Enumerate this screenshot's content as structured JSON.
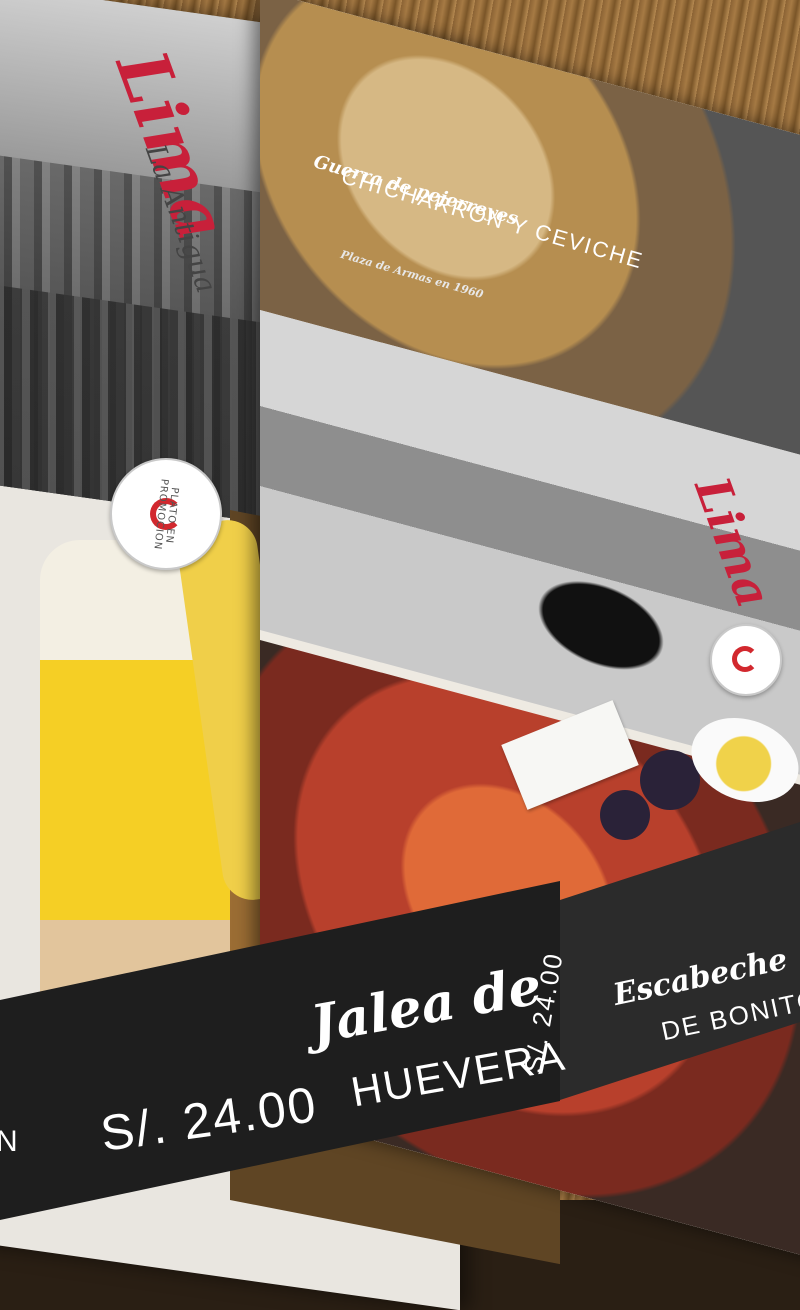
{
  "scene": {
    "description_tags": [
      "restaurant-menu",
      "peruvian-dishes"
    ]
  },
  "menu": {
    "top_right_item": {
      "script_title": "Guerra de pejerreyes",
      "name": "CHICHARRON Y CEVICHE",
      "caption": "Plaza de Armas en 1960"
    },
    "logo": {
      "word": "Lima",
      "sub": "La Antigua"
    },
    "badge_text": "PLATO EN PROMOCION",
    "middle_item": {
      "script": "Jalea de",
      "name": "HUEVERA",
      "price": "S/. 24.00"
    },
    "right_item": {
      "script": "Escabeche",
      "name": "DE BONITO"
    },
    "left_item": {
      "price": "S/. 24.00",
      "cut_letter": "N"
    }
  }
}
